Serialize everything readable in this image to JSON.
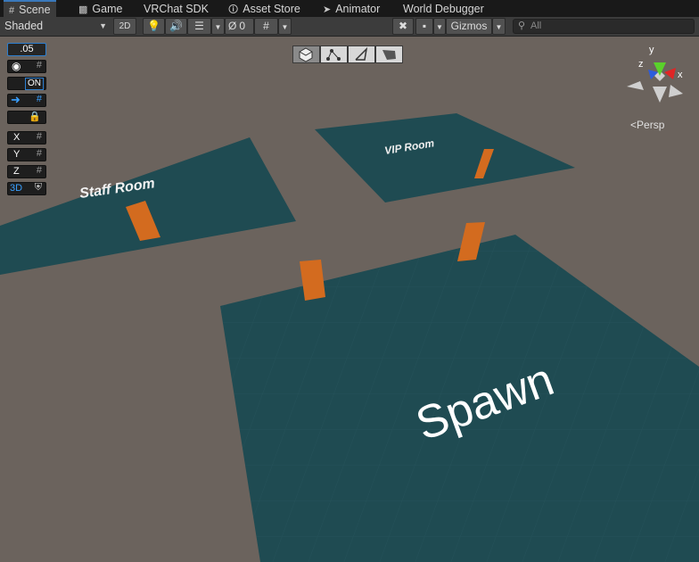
{
  "tabs": [
    {
      "label": "Scene",
      "icon": "grid-icon",
      "active": true
    },
    {
      "label": "Game",
      "icon": "gamepad-icon",
      "active": false
    },
    {
      "label": "VRChat SDK",
      "icon": "",
      "active": false
    },
    {
      "label": "Asset Store",
      "icon": "bag-icon",
      "active": false
    },
    {
      "label": "Animator",
      "icon": "animator-icon",
      "active": false
    },
    {
      "label": "World Debugger",
      "icon": "",
      "active": false
    }
  ],
  "toolbar": {
    "shading_mode": "Shaded",
    "mode_2d": "2D",
    "hidden_count": "0",
    "gizmos_label": "Gizmos",
    "search_placeholder": "All"
  },
  "left_tools": {
    "grid_size": ".05",
    "snap_state": "ON",
    "axis_x": "X",
    "axis_y": "Y",
    "axis_z": "Z",
    "mode_3d": "3D"
  },
  "scene": {
    "rooms": [
      {
        "name": "Staff Room"
      },
      {
        "name": "VIP Room"
      },
      {
        "name": "Spawn"
      }
    ],
    "floor_color": "#1f4b52",
    "portal_color": "#d36b1f"
  },
  "gizmo": {
    "axis_x": "x",
    "axis_y": "y",
    "axis_z": "z",
    "projection": "Persp",
    "colors": {
      "x": "#e02525",
      "y": "#5ad12b",
      "z": "#2c5cdc"
    }
  }
}
